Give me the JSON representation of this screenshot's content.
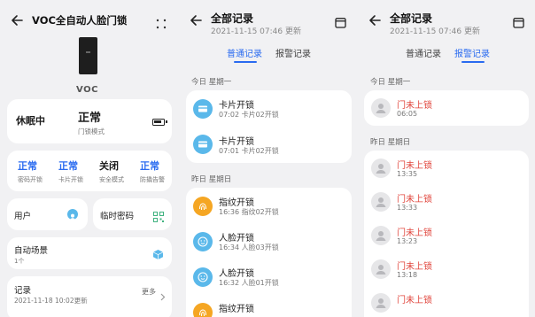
{
  "panel1": {
    "title": "VOC全自动人脸门锁",
    "brand": "VOC",
    "status": {
      "state": "休眠中",
      "mode_value": "正常",
      "mode_label": "门锁模式"
    },
    "settings": [
      {
        "value": "正常",
        "label": "密码开锁"
      },
      {
        "value": "正常",
        "label": "卡片开锁"
      },
      {
        "value": "关闭",
        "label": "安全模式"
      },
      {
        "value": "正常",
        "label": "防撬告警"
      }
    ],
    "user_label": "用户",
    "temp_pwd_label": "临时密码",
    "scene": {
      "label": "自动场景",
      "count": "1个"
    },
    "records": {
      "label": "记录",
      "more": "更多",
      "time": "2021-11-18 10:02更新"
    }
  },
  "panel2": {
    "title": "全部记录",
    "updated": "2021-11-15 07:46 更新",
    "tabs": [
      "普通记录",
      "报警记录"
    ],
    "active_tab": 0,
    "today": "今日 星期一",
    "yesterday": "昨日 星期日",
    "today_items": [
      {
        "title": "卡片开锁",
        "detail": "07:02 卡片02开锁",
        "icon": "card-icon"
      },
      {
        "title": "卡片开锁",
        "detail": "07:01 卡片02开锁",
        "icon": "card-icon"
      }
    ],
    "yesterday_items": [
      {
        "title": "指纹开锁",
        "detail": "16:36 指纹02开锁",
        "icon": "fingerprint-icon"
      },
      {
        "title": "人脸开锁",
        "detail": "16:34 人脸03开锁",
        "icon": "face-icon"
      },
      {
        "title": "人脸开锁",
        "detail": "16:32 人脸01开锁",
        "icon": "face-icon"
      },
      {
        "title": "指纹开锁",
        "detail": "",
        "icon": "fingerprint-icon"
      }
    ]
  },
  "panel3": {
    "title": "全部记录",
    "updated": "2021-11-15 07:46 更新",
    "tabs": [
      "普通记录",
      "报警记录"
    ],
    "active_tab": 1,
    "today": "今日 星期一",
    "yesterday": "昨日 星期日",
    "today_items": [
      {
        "title": "门未上锁",
        "detail": "06:05"
      }
    ],
    "yesterday_items": [
      {
        "title": "门未上锁",
        "detail": "13:35"
      },
      {
        "title": "门未上锁",
        "detail": "13:33"
      },
      {
        "title": "门未上锁",
        "detail": "13:23"
      },
      {
        "title": "门未上锁",
        "detail": "13:18"
      },
      {
        "title": "门未上锁",
        "detail": ""
      }
    ]
  },
  "colors": {
    "accent": "#2a6bf0",
    "alarm": "#e0433a",
    "card_blue": "#5ab8ea",
    "finger_orange": "#f5a623"
  }
}
